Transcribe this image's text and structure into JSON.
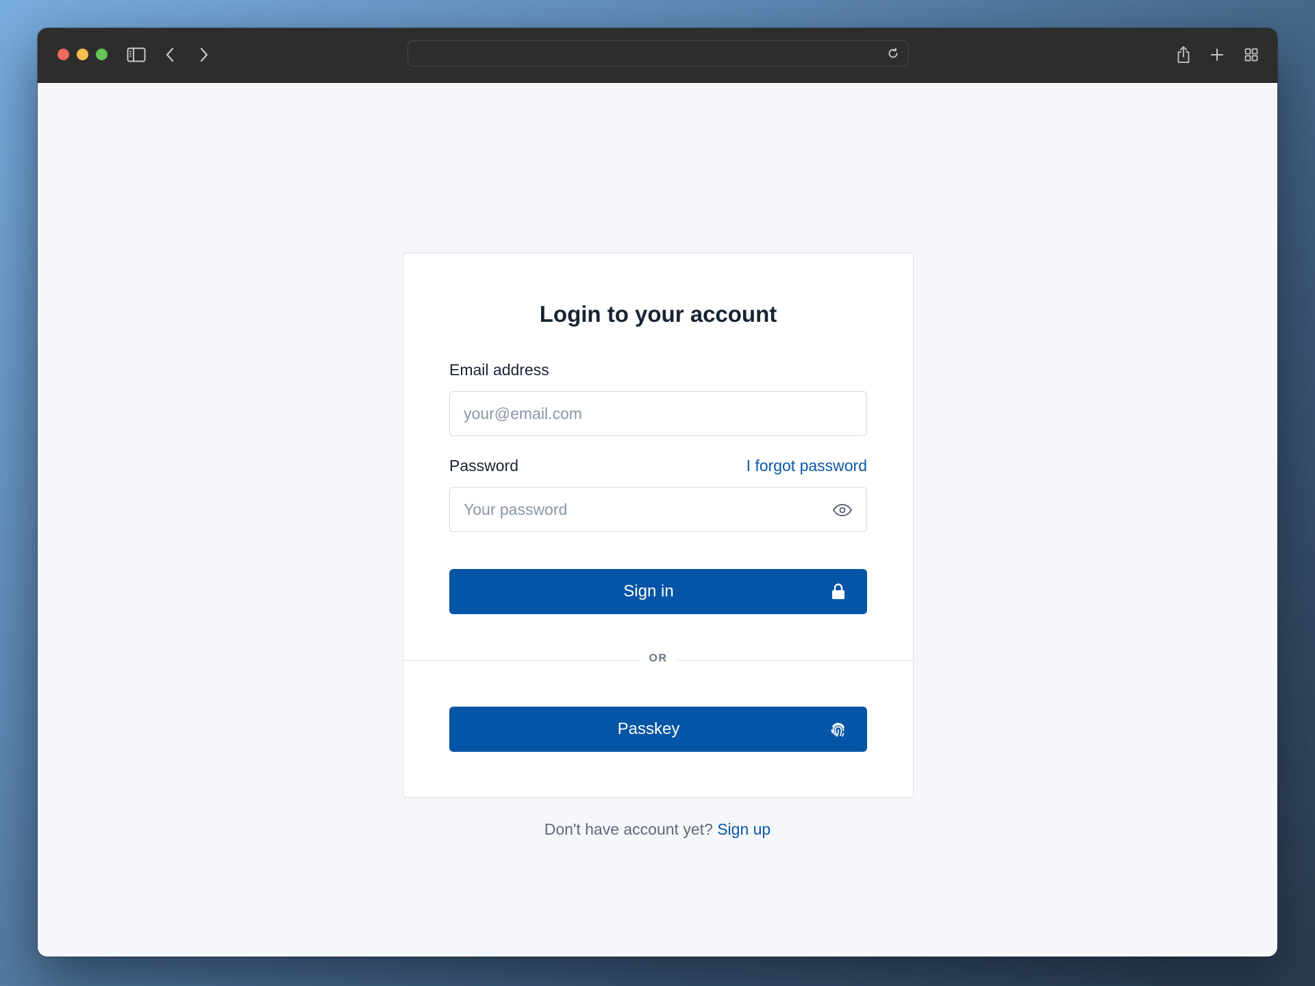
{
  "browser": {
    "address_value": "",
    "icons": {
      "sidebar": "sidebar-icon",
      "back": "chevron-left-icon",
      "forward": "chevron-right-icon",
      "reload": "reload-icon",
      "share": "share-icon",
      "new_tab": "plus-icon",
      "tab_overview": "grid-icon"
    }
  },
  "login": {
    "title": "Login to your account",
    "email_label": "Email address",
    "email_placeholder": "your@email.com",
    "email_value": "",
    "password_label": "Password",
    "forgot_link": "I forgot password",
    "password_placeholder": "Your password",
    "password_value": "",
    "sign_in_label": "Sign in",
    "divider_text": "OR",
    "passkey_label": "Passkey",
    "signup_prompt": "Don't have account yet?",
    "signup_link": "Sign up"
  },
  "colors": {
    "primary": "#0455a6",
    "link": "#0a57a8",
    "page_bg": "#f5f7fb",
    "text": "#182433"
  }
}
